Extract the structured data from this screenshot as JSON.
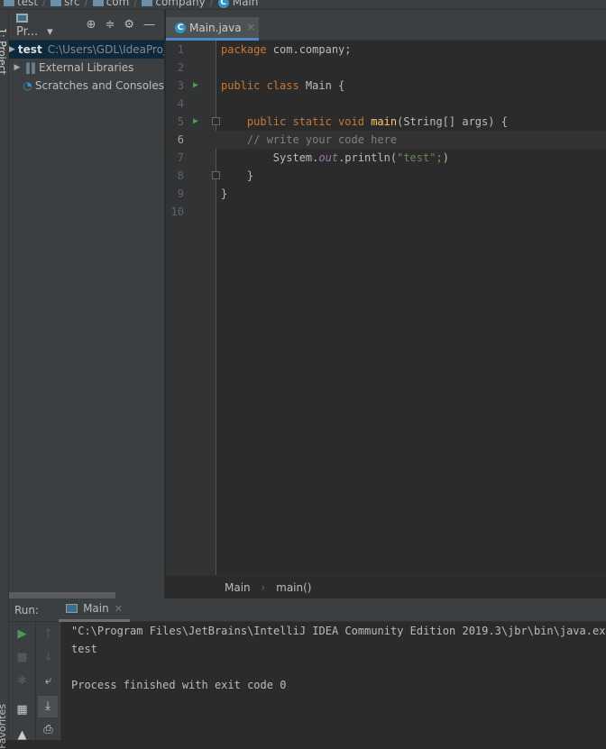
{
  "navbar": {
    "items": [
      "test",
      "src",
      "com",
      "company",
      "Main"
    ]
  },
  "side_strip": {
    "project_label": "1: Project",
    "favorites_label": "Favorites"
  },
  "project": {
    "title": "Pr...",
    "tree": [
      {
        "name": "test",
        "hint": "C:\\Users\\GDL\\IdeaProjects\\test"
      },
      {
        "name": "External Libraries"
      },
      {
        "name": "Scratches and Consoles"
      }
    ]
  },
  "editor": {
    "tab": "Main.java",
    "lines": [
      {
        "n": "1"
      },
      {
        "n": "2"
      },
      {
        "n": "3"
      },
      {
        "n": "4"
      },
      {
        "n": "5"
      },
      {
        "n": "6"
      },
      {
        "n": "7"
      },
      {
        "n": "8"
      },
      {
        "n": "9"
      },
      {
        "n": "10"
      }
    ],
    "breadcrumb": [
      "Main",
      "main()"
    ]
  },
  "run": {
    "label": "Run:",
    "tab": "Main",
    "console": [
      "\"C:\\Program Files\\JetBrains\\IntelliJ IDEA Community Edition 2019.3\\jbr\\bin\\java.exe\"",
      "test",
      "",
      "Process finished with exit code 0"
    ]
  }
}
